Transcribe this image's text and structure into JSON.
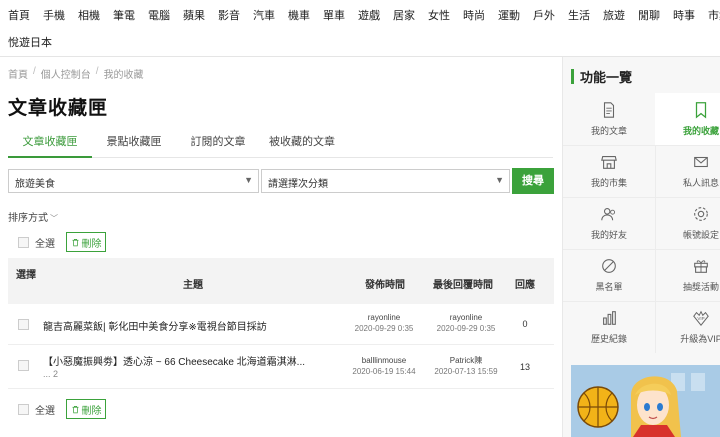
{
  "topnav": {
    "row1": [
      "首頁",
      "手機",
      "相機",
      "筆電",
      "電腦",
      "蘋果",
      "影音",
      "汽車",
      "機車",
      "單車",
      "遊戲",
      "居家",
      "女性",
      "時尚",
      "運動",
      "戶外",
      "生活",
      "旅遊",
      "閒聊",
      "時事",
      "市集"
    ],
    "row2": [
      "悅遊日本"
    ]
  },
  "breadcrumb": [
    "首頁",
    "個人控制台",
    "我的收藏"
  ],
  "page_title": "文章收藏匣",
  "tabs": [
    "文章收藏匣",
    "景點收藏匣",
    "訂閱的文章",
    "被收藏的文章"
  ],
  "filters": {
    "category": "旅遊美食",
    "subcategory": "請選擇次分類",
    "search_label": "搜尋"
  },
  "sort_label": "排序方式",
  "bulk": {
    "select_all": "全選",
    "delete": "刪除"
  },
  "table": {
    "headers": {
      "select": "選擇",
      "topic": "主題",
      "published": "發佈時間",
      "last_reply": "最後回覆時間",
      "replies": "回應"
    },
    "rows": [
      {
        "title": "龍吉高麗菜飯| 彰化田中美食分享※電視台節目採訪",
        "pages": "",
        "author": "rayonline",
        "pub_date": "2020-09-29 0:35",
        "reply_user": "rayonline",
        "reply_date": "2020-09-29 0:35",
        "replies": "0"
      },
      {
        "title": "【小惡魔振興劵】透心涼 ~ 66 Cheesecake 北海道霜淇淋...",
        "pages": "... 2",
        "author": "balllinmouse",
        "pub_date": "2020-06-19 15:44",
        "reply_user": "Patrick陳",
        "reply_date": "2020-07-13 15:59",
        "replies": "13"
      }
    ]
  },
  "sidebar": {
    "title": "功能一覽",
    "items": [
      {
        "label": "我的文章",
        "icon": "document-icon"
      },
      {
        "label": "我的收藏",
        "icon": "bookmark-icon"
      },
      {
        "label": "我的市集",
        "icon": "store-icon"
      },
      {
        "label": "私人訊息",
        "icon": "mail-icon"
      },
      {
        "label": "我的好友",
        "icon": "friends-icon"
      },
      {
        "label": "帳號設定",
        "icon": "gear-icon"
      },
      {
        "label": "黑名單",
        "icon": "block-icon"
      },
      {
        "label": "抽獎活動",
        "icon": "gift-icon"
      },
      {
        "label": "歷史紀錄",
        "icon": "chart-icon"
      },
      {
        "label": "升級為VIP",
        "icon": "vip-icon"
      }
    ]
  },
  "colors": {
    "accent": "#3ba23b"
  }
}
